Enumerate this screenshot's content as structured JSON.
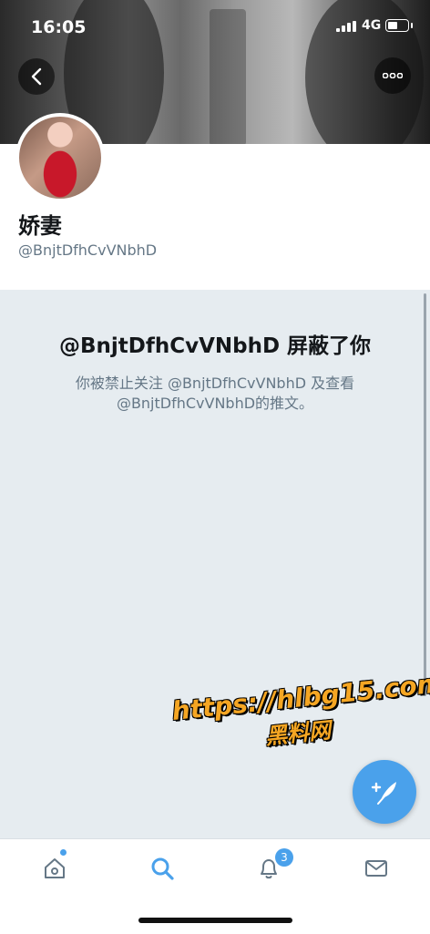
{
  "status_bar": {
    "time": "16:05",
    "network": "4G"
  },
  "profile": {
    "display_name": "娇妻",
    "handle": "@BnjtDfhCvVNbhD"
  },
  "blocked": {
    "title": "@BnjtDfhCvVNbhD 屏蔽了你",
    "description": "你被禁止关注 @BnjtDfhCvVNbhD 及查看 @BnjtDfhCvVNbhD的推文。"
  },
  "watermark": {
    "url": "https://hlbg15.com",
    "label": "黑料网"
  },
  "tabbar": {
    "notifications_badge": "3",
    "items": [
      {
        "name": "home",
        "icon": "home-icon"
      },
      {
        "name": "search",
        "icon": "search-icon",
        "active": true
      },
      {
        "name": "notifications",
        "icon": "bell-icon"
      },
      {
        "name": "messages",
        "icon": "envelope-icon"
      }
    ]
  },
  "colors": {
    "accent": "#4aa1eb",
    "blocked_bg": "#e6ecf0",
    "secondary_text": "#657786",
    "watermark": "#f5a623"
  }
}
